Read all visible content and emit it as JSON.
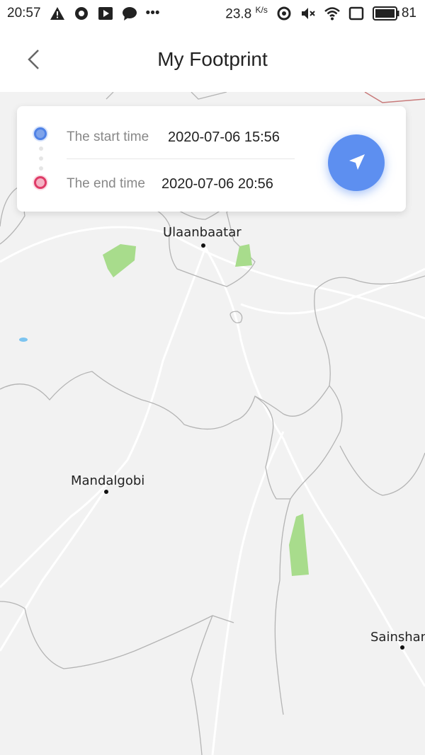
{
  "status_bar": {
    "time": "20:57",
    "more": "•••",
    "network_speed": "23.8",
    "network_unit": "K/s",
    "battery": "81"
  },
  "header": {
    "title": "My Footprint"
  },
  "time_card": {
    "start_label": "The start time",
    "start_value": "2020-07-06 15:56",
    "end_label": "The end time",
    "end_value": "2020-07-06 20:56"
  },
  "map": {
    "cities": [
      {
        "name": "Ulaanbaatar"
      },
      {
        "name": "Mandalgobi"
      },
      {
        "name": "Sainshan"
      }
    ],
    "colors": {
      "background": "#f2f2f2",
      "border": "#b0b0b0",
      "road": "#ffffff",
      "park": "#a8dc8c",
      "water": "#7cc4f0"
    }
  },
  "colors": {
    "accent": "#5d8ff0",
    "start_marker": "#4f82e6",
    "end_marker": "#df3b67"
  }
}
